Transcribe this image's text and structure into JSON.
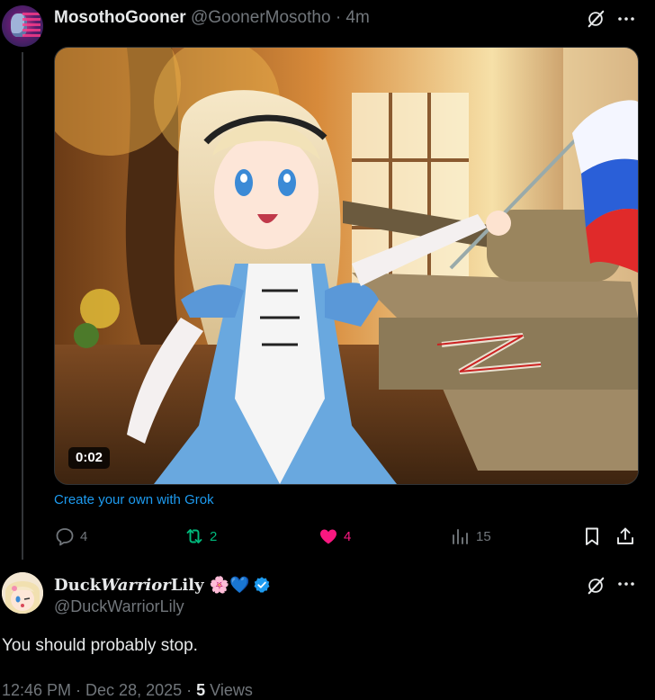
{
  "top_tweet": {
    "display_name": "MosothoGooner",
    "handle": "@GoonerMosotho",
    "separator": "·",
    "time": "4m",
    "video_duration": "0:02",
    "grok_link": "Create your own with Grok",
    "actions": {
      "replies": "4",
      "reposts": "2",
      "likes": "4",
      "views": "15"
    }
  },
  "bottom_tweet": {
    "display_name_plain_1": "Duck",
    "display_name_italic": "Warrior",
    "display_name_plain_2": "Lily",
    "display_emojis": "🌸💙",
    "handle": "@DuckWarriorLily",
    "text": "You should probably stop.",
    "timestamp": "12:46 PM · Dec 28, 2025 · ",
    "views_count": "5",
    "views_label": " Views"
  },
  "colors": {
    "accent_blue": "#1d9bf0",
    "repost_green": "#00ba7c",
    "like_pink": "#f91880",
    "muted": "#71767b"
  }
}
